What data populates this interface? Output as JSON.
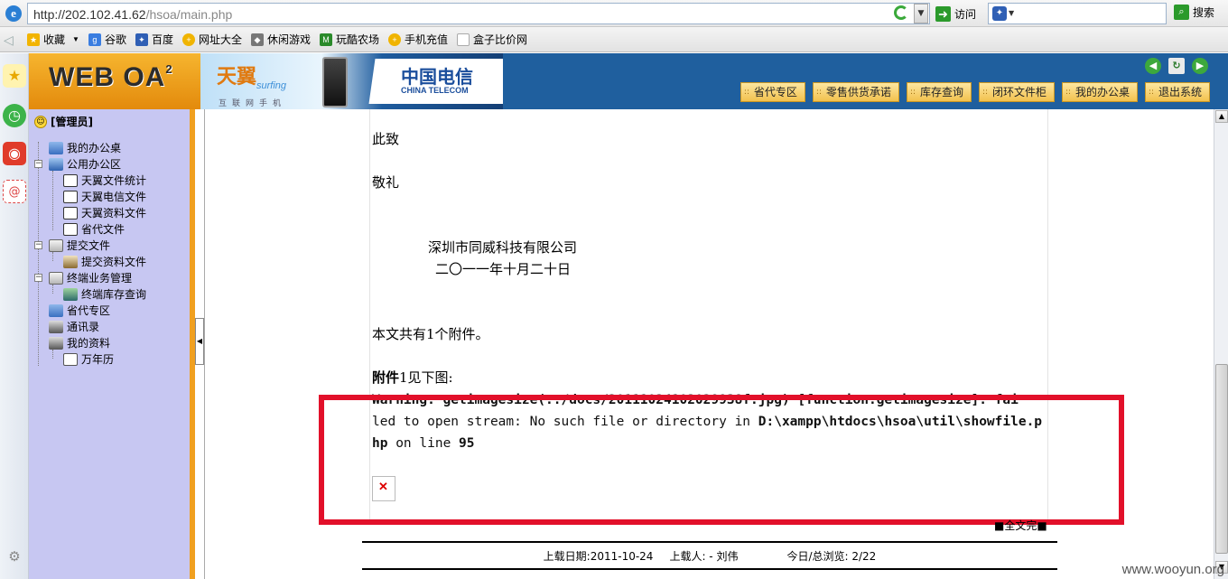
{
  "browser": {
    "url_host": "http://202.102.41.62",
    "url_path": "/hsoa/main.php",
    "go_label": "访问",
    "search_label": "搜索",
    "favorites": [
      {
        "label": "收藏",
        "icon": "star-icon",
        "color": "#f2b400"
      },
      {
        "label": "谷歌",
        "icon": "google-icon",
        "color": "#3a7de0"
      },
      {
        "label": "百度",
        "icon": "baidu-icon",
        "color": "#2f5fb5"
      },
      {
        "label": "网址大全",
        "icon": "site-icon",
        "color": "#f0b400"
      },
      {
        "label": "休闲游戏",
        "icon": "gamepad-icon",
        "color": "#777777"
      },
      {
        "label": "玩酷农场",
        "icon": "farm-icon",
        "color": "#2a8a2a"
      },
      {
        "label": "手机充值",
        "icon": "phone-icon",
        "color": "#f0b400"
      },
      {
        "label": "盒子比价网",
        "icon": "page-icon",
        "color": "#dddddd"
      }
    ]
  },
  "header": {
    "logo": "WEB OA",
    "logo_sup": "2",
    "banner_brand": "天翼",
    "banner_surfing": "surfing",
    "banner_sub": "互联网手机",
    "telecom_cn": "中国电信",
    "telecom_en": "CHINA TELECOM",
    "menu": [
      "省代专区",
      "零售供货承诺",
      "库存查询",
      "闭环文件柜",
      "我的办公桌",
      "退出系统"
    ]
  },
  "tree": {
    "user": "[管理员]",
    "items": [
      {
        "label": "我的办公桌",
        "level": 1
      },
      {
        "label": "公用办公区",
        "level": 1
      },
      {
        "label": "天翼文件统计",
        "level": 2
      },
      {
        "label": "天翼电信文件",
        "level": 2
      },
      {
        "label": "天翼资料文件",
        "level": 2
      },
      {
        "label": "省代文件",
        "level": 2
      },
      {
        "label": "提交文件",
        "level": 1
      },
      {
        "label": "提交资料文件",
        "level": 2
      },
      {
        "label": "终端业务管理",
        "level": 1
      },
      {
        "label": "终端库存查询",
        "level": 2
      },
      {
        "label": "省代专区",
        "level": 1
      },
      {
        "label": "通讯录",
        "level": 1
      },
      {
        "label": "我的资料",
        "level": 1
      },
      {
        "label": "万年历",
        "level": 2
      }
    ]
  },
  "doc": {
    "salutation1": "此致",
    "salutation2": "敬礼",
    "company": "深圳市同威科技有限公司",
    "date": "二〇一一年十月二十日",
    "attach_count": "本文共有1个附件。",
    "attach_label_bold": "附件",
    "attach_label_rest": "1见下图:",
    "warning_line1": "Warning: getimagesize(../docs/20111024102029938f.jpg) [function.getimagesize]: fai",
    "warning_line2_a": "led to open stream: No such file or directory in ",
    "warning_path": "D:\\xampp\\htdocs\\hsoa\\util\\showfile.php",
    "warning_line3_a": " on line ",
    "warning_line_no": "95",
    "full_view": "■全文完■"
  },
  "meta": {
    "upload_date": "上载日期:2011-10-24",
    "uploader": "上载人: - 刘伟",
    "views": "今日/总浏览: 2/22"
  },
  "watermark": "www.wooyun.org"
}
